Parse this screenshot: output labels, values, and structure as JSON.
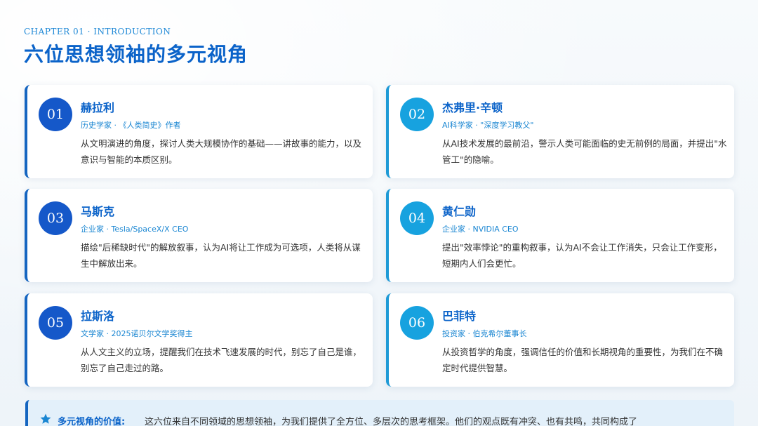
{
  "header": {
    "chapter": "CHAPTER 01 · INTRODUCTION",
    "title": "六位思想领袖的多元视角"
  },
  "cards": [
    {
      "num": "01",
      "name": "赫拉利",
      "role": "历史学家 · 《人类简史》作者",
      "desc": "从文明演进的角度，探讨人类大规模协作的基础——讲故事的能力，以及意识与智能的本质区别。"
    },
    {
      "num": "02",
      "name": "杰弗里·辛顿",
      "role": "AI科学家 · \"深度学习教父\"",
      "desc": "从AI技术发展的最前沿，警示人类可能面临的史无前例的局面，并提出\"水管工\"的隐喻。"
    },
    {
      "num": "03",
      "name": "马斯克",
      "role": "企业家 · Tesla/SpaceX/X CEO",
      "desc": "描绘\"后稀缺时代\"的解放叙事，认为AI将让工作成为可选项，人类将从谋生中解放出来。"
    },
    {
      "num": "04",
      "name": "黄仁勋",
      "role": "企业家 · NVIDIA CEO",
      "desc": "提出\"效率悖论\"的重构叙事，认为AI不会让工作消失，只会让工作变形，短期内人们会更忙。"
    },
    {
      "num": "05",
      "name": "拉斯洛",
      "role": "文学家 · 2025诺贝尔文学奖得主",
      "desc": "从人文主义的立场，提醒我们在技术飞速发展的时代，别忘了自己是谁，别忘了自己走过的路。"
    },
    {
      "num": "06",
      "name": "巴菲特",
      "role": "投资家 · 伯克希尔董事长",
      "desc": "从投资哲学的角度，强调信任的价值和长期视角的重要性，为我们在不确定时代提供智慧。"
    }
  ],
  "summary": {
    "icon": "star-icon",
    "label": "多元视角的价值:",
    "text": "这六位来自不同领域的思想领袖，为我们提供了全方位、多层次的思考框架。他们的观点既有冲突、也有共鸣，共同构成了"
  },
  "colors": {
    "primary": "#0b63c9",
    "accent": "#17a2df",
    "card_bg": "#ffffff",
    "summary_bg": "#e3f0fa"
  }
}
